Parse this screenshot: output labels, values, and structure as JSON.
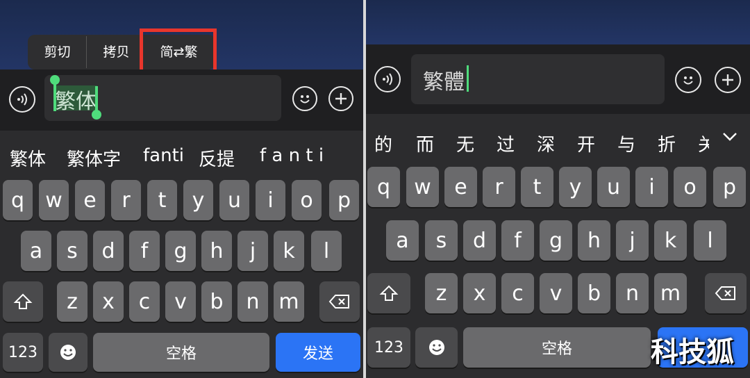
{
  "left": {
    "context_menu": {
      "cut": "剪切",
      "copy": "拷贝",
      "convert": "简⇄繁"
    },
    "input_text": "繁体",
    "candidates": [
      "繁体",
      "繁体字",
      "fanti",
      "反提",
      "f a n t i"
    ],
    "rows": [
      [
        "q",
        "w",
        "e",
        "r",
        "t",
        "y",
        "u",
        "i",
        "o",
        "p"
      ],
      [
        "a",
        "s",
        "d",
        "f",
        "g",
        "h",
        "j",
        "k",
        "l"
      ],
      [
        "z",
        "x",
        "c",
        "v",
        "b",
        "n",
        "m"
      ]
    ],
    "num_key": "123",
    "space": "空格",
    "send": "发送"
  },
  "right": {
    "input_text": "繁體",
    "candidates": [
      "的",
      "而",
      "无",
      "过",
      "深",
      "开",
      "与",
      "折",
      "关"
    ],
    "rows": [
      [
        "q",
        "w",
        "e",
        "r",
        "t",
        "y",
        "u",
        "i",
        "o",
        "p"
      ],
      [
        "a",
        "s",
        "d",
        "f",
        "g",
        "h",
        "j",
        "k",
        "l"
      ],
      [
        "z",
        "x",
        "c",
        "v",
        "b",
        "n",
        "m"
      ]
    ],
    "num_key": "123",
    "space": "空格"
  },
  "watermark": "科技狐",
  "colors": {
    "highlight_border": "#e8362c",
    "send_blue": "#2b74f5",
    "cursor_green": "#4fdc7c"
  }
}
